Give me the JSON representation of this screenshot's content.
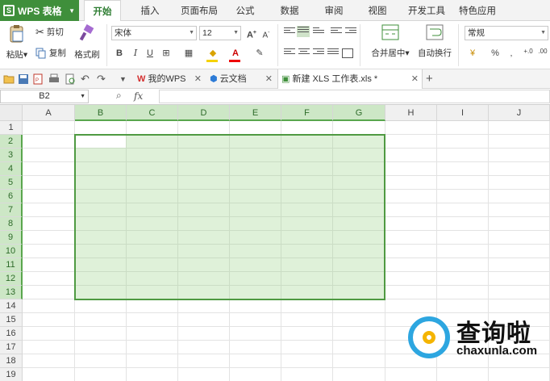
{
  "app": {
    "name": "WPS 表格"
  },
  "menu_tabs": [
    {
      "label": "开始",
      "active": true
    },
    {
      "label": "插入"
    },
    {
      "label": "页面布局"
    },
    {
      "label": "公式"
    },
    {
      "label": "数据"
    },
    {
      "label": "审阅"
    },
    {
      "label": "视图"
    },
    {
      "label": "开发工具"
    },
    {
      "label": "特色应用"
    }
  ],
  "ribbon": {
    "paste": "粘贴",
    "cut": "剪切",
    "copy": "复制",
    "format_painter": "格式刷",
    "font_name": "宋体",
    "font_size": "12",
    "bold": "B",
    "italic": "I",
    "underline": "U",
    "merge_center": "合并居中",
    "wrap_text": "自动换行",
    "number_format": "常规",
    "percent": "%",
    "comma": "‚",
    "increase_decimal": "+.0",
    "decrease_decimal": ".00"
  },
  "doc_tabs": [
    {
      "label": "我的WPS"
    },
    {
      "label": "云文档"
    },
    {
      "label": "新建 XLS 工作表.xls *",
      "active": true
    }
  ],
  "formula_bar": {
    "name_box": "B2",
    "fx": "fx",
    "value": ""
  },
  "columns": [
    "A",
    "B",
    "C",
    "D",
    "E",
    "F",
    "G",
    "H",
    "I",
    "J"
  ],
  "rows": [
    "1",
    "2",
    "3",
    "4",
    "5",
    "6",
    "7",
    "8",
    "9",
    "10",
    "11",
    "12",
    "13",
    "14",
    "15",
    "16",
    "17",
    "18",
    "19"
  ],
  "selection": {
    "range": "B2:G13",
    "active_cell": "B2"
  },
  "watermark": {
    "title": "查询啦",
    "url": "chaxunla.com"
  },
  "colors": {
    "accent": "#3f8f3b",
    "selection_fill": "#dff0d8",
    "selection_border": "#4f9a42"
  }
}
